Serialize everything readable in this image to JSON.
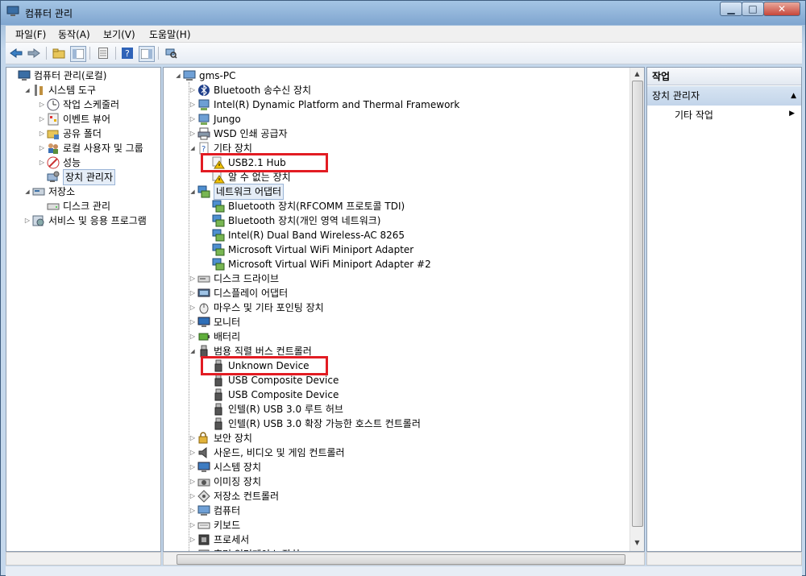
{
  "window": {
    "title": "컴퓨터 관리"
  },
  "menu": [
    "파일(F)",
    "동작(A)",
    "보기(V)",
    "도움말(H)"
  ],
  "toolbar": {
    "icons": [
      "back-icon",
      "forward-icon",
      "up-folder-icon",
      "show-tree-icon",
      "properties-icon",
      "help-icon",
      "show-action-pane-icon",
      "scan-hardware-icon"
    ]
  },
  "left_tree": [
    {
      "label": "컴퓨터 관리(로컬)",
      "depth": 0,
      "arrow": "",
      "icon": "computer-management-icon"
    },
    {
      "label": "시스템 도구",
      "depth": 1,
      "arrow": "open",
      "icon": "tools-icon"
    },
    {
      "label": "작업 스케줄러",
      "depth": 2,
      "arrow": "closed",
      "icon": "clock-icon"
    },
    {
      "label": "이벤트 뷰어",
      "depth": 2,
      "arrow": "closed",
      "icon": "event-viewer-icon"
    },
    {
      "label": "공유 폴더",
      "depth": 2,
      "arrow": "closed",
      "icon": "shared-folder-icon"
    },
    {
      "label": "로컬 사용자 및 그룹",
      "depth": 2,
      "arrow": "closed",
      "icon": "users-icon"
    },
    {
      "label": "성능",
      "depth": 2,
      "arrow": "closed",
      "icon": "performance-icon"
    },
    {
      "label": "장치 관리자",
      "depth": 2,
      "arrow": "",
      "icon": "device-manager-icon",
      "selected": true
    },
    {
      "label": "저장소",
      "depth": 1,
      "arrow": "open",
      "icon": "storage-icon"
    },
    {
      "label": "디스크 관리",
      "depth": 2,
      "arrow": "",
      "icon": "disk-icon"
    },
    {
      "label": "서비스 및 응용 프로그램",
      "depth": 1,
      "arrow": "closed",
      "icon": "services-icon"
    }
  ],
  "device_tree": [
    {
      "label": "gms-PC",
      "depth": 0,
      "arrow": "open",
      "icon": "computer-icon"
    },
    {
      "label": "Bluetooth 송수신 장치",
      "depth": 1,
      "arrow": "closed",
      "icon": "bluetooth-icon"
    },
    {
      "label": "Intel(R) Dynamic Platform and Thermal Framework",
      "depth": 1,
      "arrow": "closed",
      "icon": "device-icon"
    },
    {
      "label": "Jungo",
      "depth": 1,
      "arrow": "closed",
      "icon": "device-icon"
    },
    {
      "label": "WSD 인쇄 공급자",
      "depth": 1,
      "arrow": "closed",
      "icon": "printer-icon"
    },
    {
      "label": "기타 장치",
      "depth": 1,
      "arrow": "open",
      "icon": "other-devices-icon"
    },
    {
      "label": "USB2.1 Hub",
      "depth": 2,
      "arrow": "",
      "icon": "warning-icon",
      "highlight": true
    },
    {
      "label": "알 수 없는 장치",
      "depth": 2,
      "arrow": "",
      "icon": "warning-icon"
    },
    {
      "label": "네트워크 어댑터",
      "depth": 1,
      "arrow": "open",
      "icon": "network-adapter-icon",
      "selected": true
    },
    {
      "label": "Bluetooth 장치(RFCOMM 프로토콜 TDI)",
      "depth": 2,
      "arrow": "",
      "icon": "network-adapter-icon"
    },
    {
      "label": "Bluetooth 장치(개인 영역 네트워크)",
      "depth": 2,
      "arrow": "",
      "icon": "network-adapter-icon"
    },
    {
      "label": "Intel(R) Dual Band Wireless-AC 8265",
      "depth": 2,
      "arrow": "",
      "icon": "network-adapter-icon"
    },
    {
      "label": "Microsoft Virtual WiFi Miniport Adapter",
      "depth": 2,
      "arrow": "",
      "icon": "network-adapter-icon"
    },
    {
      "label": "Microsoft Virtual WiFi Miniport Adapter #2",
      "depth": 2,
      "arrow": "",
      "icon": "network-adapter-icon"
    },
    {
      "label": "디스크 드라이브",
      "depth": 1,
      "arrow": "closed",
      "icon": "disk-drive-icon"
    },
    {
      "label": "디스플레이 어댑터",
      "depth": 1,
      "arrow": "closed",
      "icon": "display-adapter-icon"
    },
    {
      "label": "마우스 및 기타 포인팅 장치",
      "depth": 1,
      "arrow": "closed",
      "icon": "mouse-icon"
    },
    {
      "label": "모니터",
      "depth": 1,
      "arrow": "closed",
      "icon": "monitor-icon"
    },
    {
      "label": "배터리",
      "depth": 1,
      "arrow": "closed",
      "icon": "battery-icon"
    },
    {
      "label": "범용 직렬 버스 컨트롤러",
      "depth": 1,
      "arrow": "open",
      "icon": "usb-icon"
    },
    {
      "label": "Unknown Device",
      "depth": 2,
      "arrow": "",
      "icon": "usb-icon",
      "highlight": true
    },
    {
      "label": "USB Composite Device",
      "depth": 2,
      "arrow": "",
      "icon": "usb-icon"
    },
    {
      "label": "USB Composite Device",
      "depth": 2,
      "arrow": "",
      "icon": "usb-icon"
    },
    {
      "label": "인텔(R) USB 3.0 루트 허브",
      "depth": 2,
      "arrow": "",
      "icon": "usb-icon"
    },
    {
      "label": "인텔(R) USB 3.0 확장 가능한 호스트 컨트롤러",
      "depth": 2,
      "arrow": "",
      "icon": "usb-icon"
    },
    {
      "label": "보안 장치",
      "depth": 1,
      "arrow": "closed",
      "icon": "security-icon"
    },
    {
      "label": "사운드, 비디오 및 게임 컨트롤러",
      "depth": 1,
      "arrow": "closed",
      "icon": "sound-icon"
    },
    {
      "label": "시스템 장치",
      "depth": 1,
      "arrow": "closed",
      "icon": "system-device-icon"
    },
    {
      "label": "이미징 장치",
      "depth": 1,
      "arrow": "closed",
      "icon": "imaging-icon"
    },
    {
      "label": "저장소 컨트롤러",
      "depth": 1,
      "arrow": "closed",
      "icon": "storage-controller-icon"
    },
    {
      "label": "컴퓨터",
      "depth": 1,
      "arrow": "closed",
      "icon": "computer-icon"
    },
    {
      "label": "키보드",
      "depth": 1,
      "arrow": "closed",
      "icon": "keyboard-icon"
    },
    {
      "label": "프로세서",
      "depth": 1,
      "arrow": "closed",
      "icon": "processor-icon"
    },
    {
      "label": "휴먼 인터페이스 장치",
      "depth": 1,
      "arrow": "closed",
      "icon": "hid-icon"
    }
  ],
  "actions": {
    "header": "작업",
    "section": "장치 관리자",
    "item": "기타 작업"
  }
}
